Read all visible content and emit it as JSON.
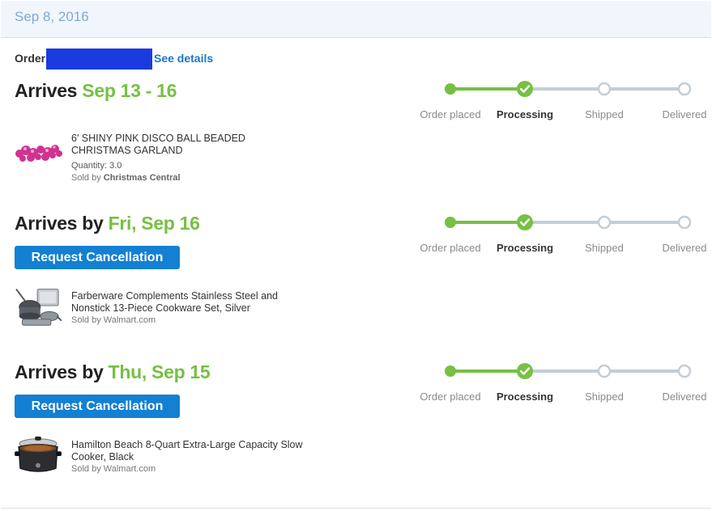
{
  "order_group": {
    "date": "Sep 8, 2016",
    "order_label": "Order",
    "see_details": "See details"
  },
  "steps": [
    "Order placed",
    "Processing",
    "Shipped",
    "Delivered"
  ],
  "colors": {
    "accent_green": "#76c043",
    "button_blue": "#1380d2",
    "link_blue": "#1a75cf",
    "track_grey": "#c4cdd5"
  },
  "shipments": [
    {
      "arrives_prefix": "Arrives",
      "arrives_when": "Sep 13 - 16",
      "current_step": 1,
      "item": {
        "title": "6' SHINY PINK DISCO BALL BEADED CHRISTMAS GARLAND",
        "quantity_label": "Quantity:",
        "quantity": "3.0",
        "sold_by_label": "Sold by",
        "seller": "Christmas Central",
        "thumb_icon": "pink-bead-garland-icon"
      }
    },
    {
      "arrives_prefix": "Arrives by",
      "arrives_when": "Fri, Sep 16",
      "current_step": 1,
      "cancel_label": "Request Cancellation",
      "item": {
        "title": "Farberware Complements Stainless Steel and Nonstick 13-Piece Cookware Set, Silver",
        "sold_by": "Sold by Walmart.com",
        "thumb_icon": "cookware-set-icon"
      }
    },
    {
      "arrives_prefix": "Arrives by",
      "arrives_when": "Thu, Sep 15",
      "current_step": 1,
      "cancel_label": "Request Cancellation",
      "item": {
        "title": "Hamilton Beach 8-Quart Extra-Large Capacity Slow Cooker, Black",
        "sold_by": "Sold by Walmart.com",
        "thumb_icon": "slow-cooker-icon"
      }
    }
  ]
}
